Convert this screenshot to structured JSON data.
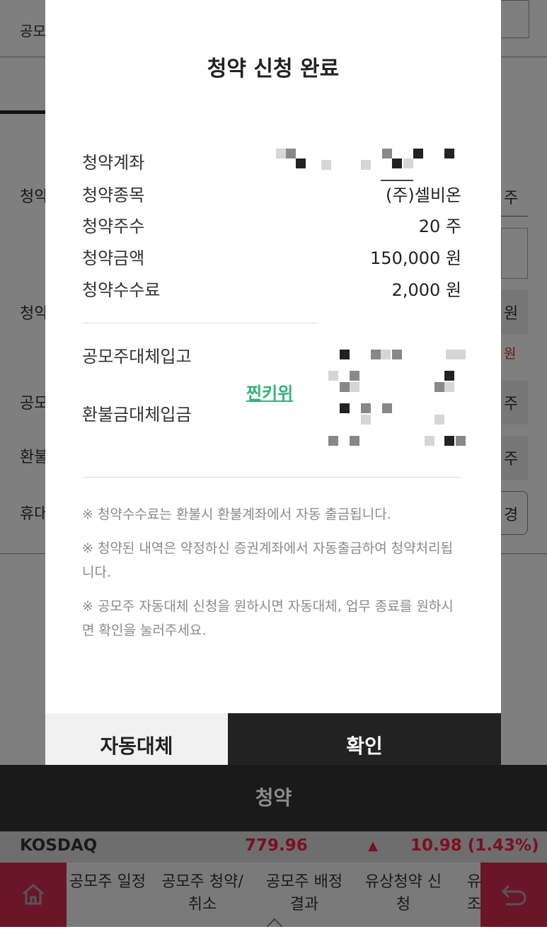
{
  "background": {
    "partial_texts": [
      "공모",
      "청약",
      "청약",
      "공모",
      "환불",
      "휴대",
      "주",
      "원",
      "원",
      "주",
      "주",
      "경"
    ]
  },
  "modal": {
    "title": "청약 신청 완료",
    "rows": [
      {
        "label": "청약계좌",
        "value": ""
      },
      {
        "label": "청약종목",
        "value": "(주)셀비온"
      },
      {
        "label": "청약주수",
        "value": "20 주"
      },
      {
        "label": "청약금액",
        "value": "150,000 원"
      },
      {
        "label": "청약수수료",
        "value": "2,000 원"
      }
    ],
    "refund_rows": [
      {
        "label": "공모주대체입고"
      },
      {
        "label": "환불금대체입금"
      }
    ],
    "watermark": "찐키위",
    "notes": [
      "※ 청약수수료는 환불시 환불계좌에서 자동 출금됩니다.",
      "※ 청약된 내역은 약정하신 증권계좌에서 자동출금하여 청약처리됩니다.",
      "※ 공모주 자동대체 신청을 원하시면 자동대체, 업무 종료를 원하시면 확인을 눌러주세요."
    ],
    "buttons": {
      "auto": "자동대체",
      "ok": "확인"
    }
  },
  "bottom_bar": {
    "label": "청약"
  },
  "ticker": {
    "index": "KOSDAQ",
    "value": "779.96",
    "arrow": "▲",
    "change": "10.98 (1.43%)",
    "color_up": "#e0323a"
  },
  "nav": {
    "items": [
      {
        "label": "공모주 일정"
      },
      {
        "label": "공모주 청약/취소"
      },
      {
        "label": "공모주 배정결과"
      },
      {
        "label": "유상청약 신청"
      },
      {
        "label": "유 조"
      }
    ],
    "home_icon": "home-icon",
    "back_icon": "back-icon",
    "accent": "#b8274b"
  }
}
